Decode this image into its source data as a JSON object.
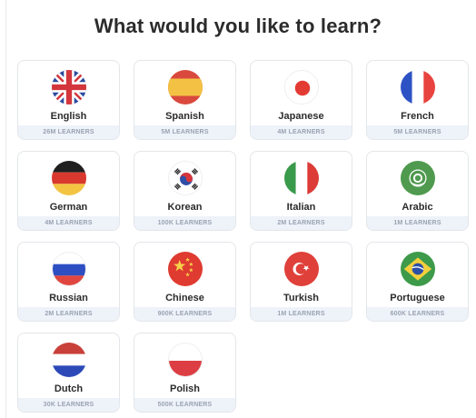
{
  "page": {
    "title": "What would you like to learn?"
  },
  "languages": [
    {
      "name": "English",
      "learners": "26M LEARNERS",
      "flag": "flag-uk-icon"
    },
    {
      "name": "Spanish",
      "learners": "5M LEARNERS",
      "flag": "flag-spain-icon"
    },
    {
      "name": "Japanese",
      "learners": "4M LEARNERS",
      "flag": "flag-japan-icon"
    },
    {
      "name": "French",
      "learners": "5M LEARNERS",
      "flag": "flag-france-icon"
    },
    {
      "name": "German",
      "learners": "4M LEARNERS",
      "flag": "flag-germany-icon"
    },
    {
      "name": "Korean",
      "learners": "100K LEARNERS",
      "flag": "flag-korea-icon"
    },
    {
      "name": "Italian",
      "learners": "2M LEARNERS",
      "flag": "flag-italy-icon"
    },
    {
      "name": "Arabic",
      "learners": "1M LEARNERS",
      "flag": "flag-arab-league-icon"
    },
    {
      "name": "Russian",
      "learners": "2M LEARNERS",
      "flag": "flag-russia-icon"
    },
    {
      "name": "Chinese",
      "learners": "900K LEARNERS",
      "flag": "flag-china-icon"
    },
    {
      "name": "Turkish",
      "learners": "1M LEARNERS",
      "flag": "flag-turkey-icon"
    },
    {
      "name": "Portuguese",
      "learners": "600K LEARNERS",
      "flag": "flag-brazil-icon"
    },
    {
      "name": "Dutch",
      "learners": "30K LEARNERS",
      "flag": "flag-netherlands-icon"
    },
    {
      "name": "Polish",
      "learners": "500K LEARNERS",
      "flag": "flag-poland-icon"
    }
  ]
}
